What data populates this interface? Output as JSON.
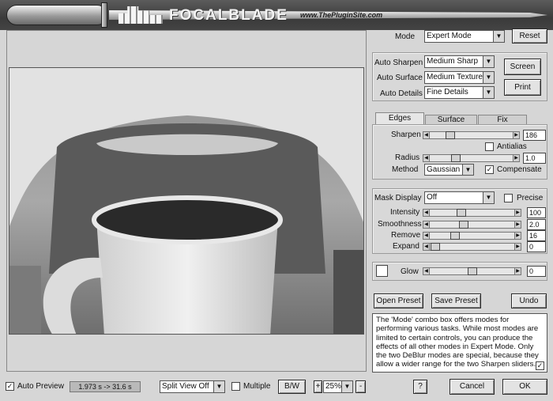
{
  "banner": {
    "brand": "FOCALBLADE",
    "url": "www.ThePluginSite.com"
  },
  "mode": {
    "label": "Mode",
    "value": "Expert Mode",
    "reset": "Reset"
  },
  "auto": {
    "sharpen_label": "Auto Sharpen",
    "sharpen_value": "Medium Sharp",
    "surface_label": "Auto Surface",
    "surface_value": "Medium Textured",
    "details_label": "Auto Details",
    "details_value": "Fine Details",
    "screen": "Screen",
    "print": "Print"
  },
  "tabs": [
    "Edges",
    "Surface",
    "Fix"
  ],
  "edges": {
    "sharpen_label": "Sharpen",
    "sharpen_value": "186",
    "antialias_label": "Antialias",
    "antialias_checked": false,
    "radius_label": "Radius",
    "radius_value": "1.0",
    "method_label": "Method",
    "method_value": "Gaussian",
    "compensate_label": "Compensate",
    "compensate_checked": true
  },
  "mask": {
    "display_label": "Mask Display",
    "display_value": "Off",
    "precise_label": "Precise",
    "precise_checked": false,
    "intensity_label": "Intensity",
    "intensity_value": "100",
    "smoothness_label": "Smoothness",
    "smoothness_value": "2.0",
    "remove_label": "Remove",
    "remove_value": "16",
    "expand_label": "Expand",
    "expand_value": "0"
  },
  "glow": {
    "label": "Glow",
    "value": "0"
  },
  "presets": {
    "open": "Open Preset",
    "save": "Save Preset",
    "undo": "Undo"
  },
  "help_text": "The 'Mode' combo box offers modes for performing various tasks. While most modes are limited to certain controls, you can produce the effects of all other modes in Expert Mode. Only the two DeBlur modes are special, because they allow a wider range for the two Sharpen sliders.",
  "bottom": {
    "auto_preview_label": "Auto Preview",
    "auto_preview_checked": true,
    "timing": "1.973 s -> 31.6 s",
    "split_view": "Split View Off",
    "multiple_label": "Multiple",
    "multiple_checked": false,
    "bw": "B/W",
    "zoom_plus": "+",
    "zoom": "25%",
    "zoom_minus": "-",
    "help": "?",
    "cancel": "Cancel",
    "ok": "OK"
  },
  "icons": {
    "check": "check-icon",
    "arrow": "dropdown-arrow-icon"
  }
}
